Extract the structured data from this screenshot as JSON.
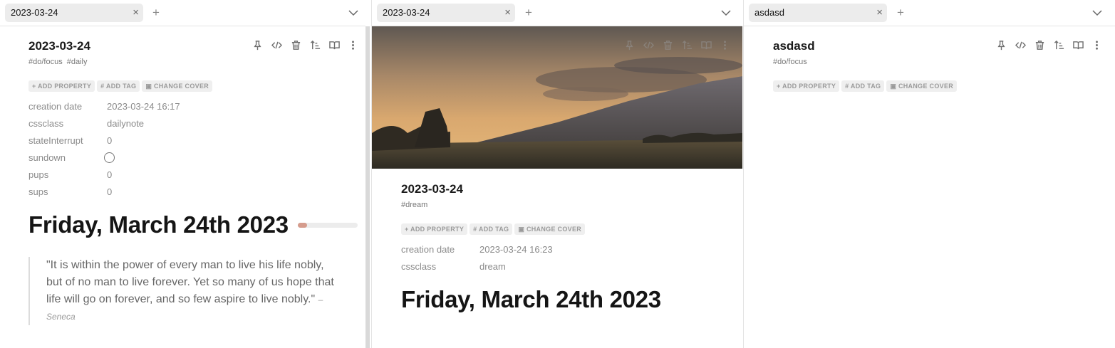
{
  "panes": [
    {
      "tab": {
        "label": "2023-03-24"
      },
      "note": {
        "title": "2023-03-24",
        "tags": [
          "#do/focus",
          "#daily"
        ],
        "chips": [
          "+ ADD PROPERTY",
          "# ADD TAG",
          "▣ CHANGE COVER"
        ],
        "properties": [
          {
            "key": "creation date",
            "value": "2023-03-24 16:17"
          },
          {
            "key": "cssclass",
            "value": "dailynote"
          },
          {
            "key": "stateInterrupt",
            "value": "0"
          },
          {
            "key": "sundown",
            "value": ""
          },
          {
            "key": "pups",
            "value": "0"
          },
          {
            "key": "sups",
            "value": "0"
          }
        ],
        "heading": "Friday, March 24th 2023",
        "day_progress": 0.15,
        "quote": {
          "text": "\"It is within the power of every man to live his life nobly, but of no man to live forever. Yet so many of us hope that life will go on forever, and so few aspire to live nobly.\"",
          "author": "– Seneca"
        }
      }
    },
    {
      "tab": {
        "label": "2023-03-24"
      },
      "note": {
        "title": "2023-03-24",
        "tags": [
          "#dream"
        ],
        "chips": [
          "+ ADD PROPERTY",
          "# ADD TAG",
          "▣ CHANGE COVER"
        ],
        "properties": [
          {
            "key": "creation date",
            "value": "2023-03-24 16:23"
          },
          {
            "key": "cssclass",
            "value": "dream"
          }
        ],
        "heading": "Friday, March 24th 2023"
      }
    },
    {
      "tab": {
        "label": "asdasd"
      },
      "note": {
        "title": "asdasd",
        "tags": [
          "#do/focus"
        ],
        "chips": [
          "+ ADD PROPERTY",
          "# ADD TAG",
          "▣ CHANGE COVER"
        ]
      }
    }
  ],
  "icons": {
    "tab_close": "×",
    "tab_new": "+",
    "actions": [
      "pin-icon",
      "code-icon",
      "trash-icon",
      "sort-icon",
      "book-icon",
      "more-icon"
    ]
  },
  "colors": {
    "progress_fill": "#d59c8d",
    "accent_text": "#151515"
  }
}
